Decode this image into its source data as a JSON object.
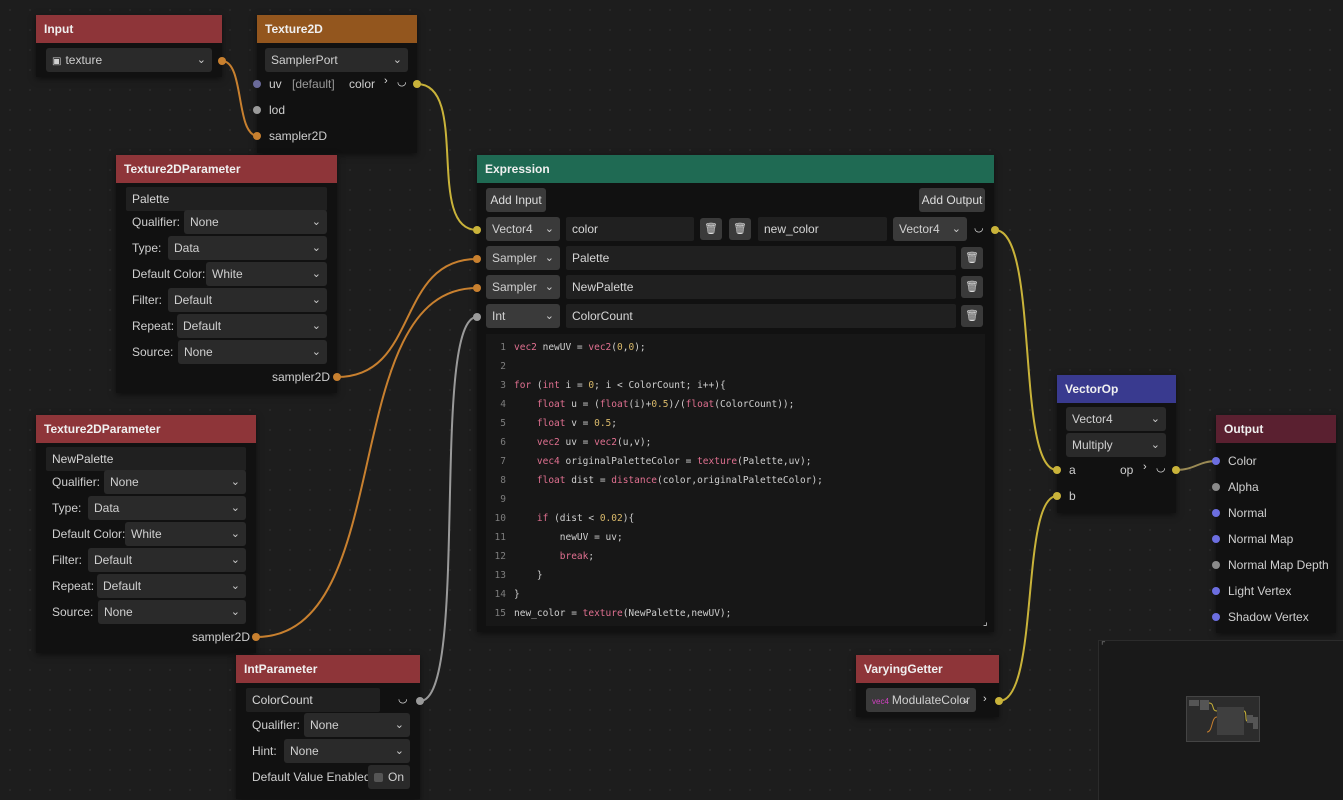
{
  "nodes": {
    "input": {
      "title": "Input",
      "select_value": "texture"
    },
    "texture2d": {
      "title": "Texture2D",
      "select_value": "SamplerPort",
      "uv_label": "uv",
      "uv_default": "[default]",
      "color_label": "color",
      "lod_label": "lod",
      "sampler_label": "sampler2D"
    },
    "param1": {
      "title": "Texture2DParameter",
      "name": "Palette",
      "qualifier_label": "Qualifier:",
      "qualifier_value": "None",
      "type_label": "Type:",
      "type_value": "Data",
      "default_color_label": "Default Color:",
      "default_color_value": "White",
      "filter_label": "Filter:",
      "filter_value": "Default",
      "repeat_label": "Repeat:",
      "repeat_value": "Default",
      "source_label": "Source:",
      "source_value": "None",
      "output_label": "sampler2D"
    },
    "param2": {
      "title": "Texture2DParameter",
      "name": "NewPalette",
      "qualifier_label": "Qualifier:",
      "qualifier_value": "None",
      "type_label": "Type:",
      "type_value": "Data",
      "default_color_label": "Default Color:",
      "default_color_value": "White",
      "filter_label": "Filter:",
      "filter_value": "Default",
      "repeat_label": "Repeat:",
      "repeat_value": "Default",
      "source_label": "Source:",
      "source_value": "None",
      "output_label": "sampler2D"
    },
    "intparam": {
      "title": "IntParameter",
      "name": "ColorCount",
      "qualifier_label": "Qualifier:",
      "qualifier_value": "None",
      "hint_label": "Hint:",
      "hint_value": "None",
      "default_label": "Default Value Enabled:",
      "toggle_label": "On"
    },
    "expression": {
      "title": "Expression",
      "add_input": "Add Input",
      "add_output": "Add Output",
      "inputs": [
        {
          "type": "Vector4",
          "name": "color"
        },
        {
          "type": "Sampler",
          "name": "Palette"
        },
        {
          "type": "Sampler",
          "name": "NewPalette"
        },
        {
          "type": "Int",
          "name": "ColorCount"
        }
      ],
      "output": {
        "name": "new_color",
        "type": "Vector4"
      },
      "code": [
        {
          "n": "1",
          "t": "vec2 newUV = vec2(0,0);"
        },
        {
          "n": "2",
          "t": ""
        },
        {
          "n": "3",
          "t": "for (int i = 0; i < ColorCount; i++){"
        },
        {
          "n": "4",
          "t": "    float u = (float(i)+0.5)/(float(ColorCount));"
        },
        {
          "n": "5",
          "t": "    float v = 0.5;"
        },
        {
          "n": "6",
          "t": "    vec2 uv = vec2(u,v);"
        },
        {
          "n": "7",
          "t": "    vec4 originalPaletteColor = texture(Palette,uv);"
        },
        {
          "n": "8",
          "t": "    float dist = distance(color,originalPaletteColor);"
        },
        {
          "n": "9",
          "t": ""
        },
        {
          "n": "10",
          "t": "    if (dist < 0.02){"
        },
        {
          "n": "11",
          "t": "        newUV = uv;"
        },
        {
          "n": "12",
          "t": "        break;"
        },
        {
          "n": "13",
          "t": "    }"
        },
        {
          "n": "14",
          "t": "}"
        },
        {
          "n": "15",
          "t": "new_color = texture(NewPalette,newUV);"
        }
      ]
    },
    "vectorop": {
      "title": "VectorOp",
      "type_value": "Vector4",
      "op_value": "Multiply",
      "a_label": "a",
      "b_label": "b",
      "op_label": "op"
    },
    "output": {
      "title": "Output",
      "ports": [
        "Color",
        "Alpha",
        "Normal",
        "Normal Map",
        "Normal Map Depth",
        "Light Vertex",
        "Shadow Vertex"
      ]
    },
    "varying": {
      "title": "VaryingGetter",
      "select_value": "ModulateColor"
    }
  },
  "colors": {
    "wire_orange": "#c8802f",
    "wire_yellow": "#c9b33a",
    "wire_gray": "#9a9a9a"
  }
}
